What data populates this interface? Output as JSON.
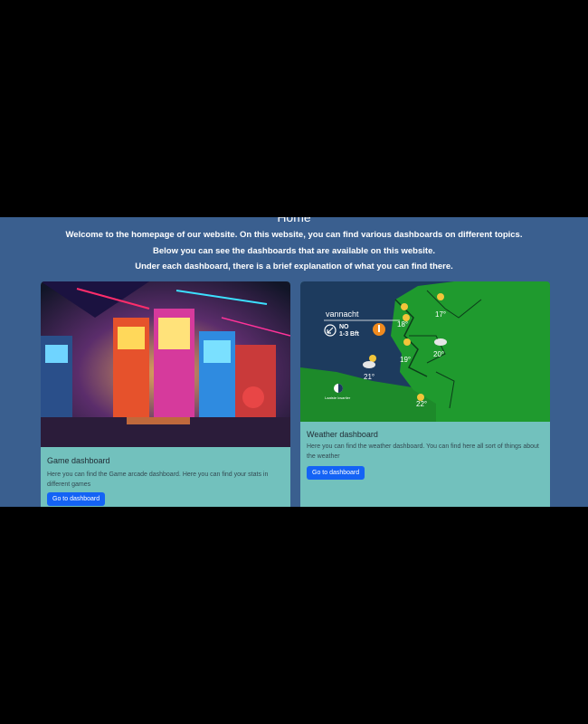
{
  "hero": {
    "title": "Home",
    "line1": "Welcome to the homepage of our website. On this website, you can find various dashboards on different topics.",
    "line2": "Below you can see the dashboards that are available on this website.",
    "line3": "Under each dashboard, there is a brief explanation of what you can find there."
  },
  "cards": [
    {
      "title": "Game dashboard",
      "text": "Here you can find the Game arcade dashboard. Here you can find your stats in different games",
      "button": "Go to dashboard"
    },
    {
      "title": "Weather dashboard",
      "text": "Here you can find the weather dashboard. You can find here all sort of things about the weather",
      "button": "Go to dashboard",
      "map": {
        "label": "vannacht",
        "wind_dir": "NO",
        "wind_speed": "1-3 Bft",
        "legend": "Laatste kwartier",
        "temps": [
          "17°",
          "18°",
          "19°",
          "20°",
          "21°",
          "22°"
        ]
      }
    }
  ]
}
